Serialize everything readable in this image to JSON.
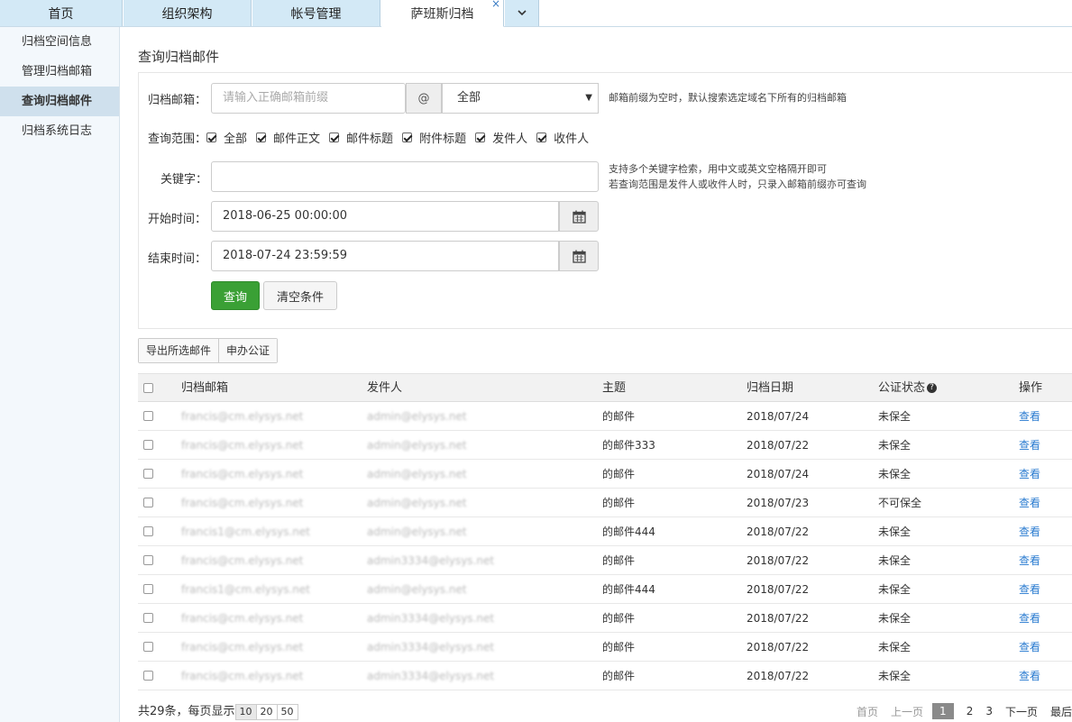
{
  "tabs": [
    {
      "label": "首页"
    },
    {
      "label": "组织架构"
    },
    {
      "label": "帐号管理"
    },
    {
      "label": "萨班斯归档",
      "close": "×"
    }
  ],
  "tab_more_icon": "chevron-down-icon",
  "sidebar": {
    "items": [
      {
        "label": "归档空间信息"
      },
      {
        "label": "管理归档邮箱"
      },
      {
        "label": "查询归档邮件"
      },
      {
        "label": "归档系统日志"
      }
    ]
  },
  "page_title": "查询归档邮件",
  "form": {
    "mailbox_label": "归档邮箱：",
    "mailbox_placeholder": "请输入正确邮箱前缀",
    "at_symbol": "@",
    "domain_selected": "全部",
    "mailbox_hint": "邮箱前缀为空时，默认搜索选定域名下所有的归档邮箱",
    "scope_label": "查询范围：",
    "scope_options": [
      {
        "label": "全部",
        "checked": true
      },
      {
        "label": "邮件正文",
        "checked": true
      },
      {
        "label": "邮件标题",
        "checked": true
      },
      {
        "label": "附件标题",
        "checked": true
      },
      {
        "label": "发件人",
        "checked": true
      },
      {
        "label": "收件人",
        "checked": true
      }
    ],
    "keyword_label": "关键字：",
    "keyword_value": "",
    "keyword_hint_1": "支持多个关键字检索，用中文或英文空格隔开即可",
    "keyword_hint_2": "若查询范围是发件人或收件人时，只录入邮箱前缀亦可查询",
    "start_label": "开始时间：",
    "start_value": "2018-06-25 00:00:00",
    "end_label": "结束时间：",
    "end_value": "2018-07-24 23:59:59",
    "calendar_icon": "calendar-icon",
    "search_button": "查询",
    "clear_button": "清空条件"
  },
  "actions": {
    "export_button": "导出所选邮件",
    "notarize_button": "申办公证"
  },
  "table": {
    "headers": {
      "mailbox": "归档邮箱",
      "sender": "发件人",
      "subject": "主题",
      "date": "归档日期",
      "status": "公证状态",
      "action": "操作"
    },
    "help_icon": "question-circle-icon",
    "rows": [
      {
        "mailbox": "francis@cm.elysys.net",
        "sender": "admin@elysys.net",
        "subject": "的邮件",
        "date": "2018/07/24",
        "status": "未保全",
        "action": "查看"
      },
      {
        "mailbox": "francis@cm.elysys.net",
        "sender": "admin@elysys.net",
        "subject": "的邮件333",
        "date": "2018/07/22",
        "status": "未保全",
        "action": "查看"
      },
      {
        "mailbox": "francis@cm.elysys.net",
        "sender": "admin@elysys.net",
        "subject": "的邮件",
        "date": "2018/07/24",
        "status": "未保全",
        "action": "查看"
      },
      {
        "mailbox": "francis@cm.elysys.net",
        "sender": "admin@elysys.net",
        "subject": "的邮件",
        "date": "2018/07/23",
        "status": "不可保全",
        "action": "查看"
      },
      {
        "mailbox": "francis1@cm.elysys.net",
        "sender": "admin@elysys.net",
        "subject": "的邮件444",
        "date": "2018/07/22",
        "status": "未保全",
        "action": "查看"
      },
      {
        "mailbox": "francis@cm.elysys.net",
        "sender": "admin3334@elysys.net",
        "subject": "的邮件",
        "date": "2018/07/22",
        "status": "未保全",
        "action": "查看"
      },
      {
        "mailbox": "francis1@cm.elysys.net",
        "sender": "admin@elysys.net",
        "subject": "的邮件444",
        "date": "2018/07/22",
        "status": "未保全",
        "action": "查看"
      },
      {
        "mailbox": "francis@cm.elysys.net",
        "sender": "admin3334@elysys.net",
        "subject": "的邮件",
        "date": "2018/07/22",
        "status": "未保全",
        "action": "查看"
      },
      {
        "mailbox": "francis@cm.elysys.net",
        "sender": "admin3334@elysys.net",
        "subject": "的邮件",
        "date": "2018/07/22",
        "status": "未保全",
        "action": "查看"
      },
      {
        "mailbox": "francis@cm.elysys.net",
        "sender": "admin3334@elysys.net",
        "subject": "的邮件",
        "date": "2018/07/22",
        "status": "未保全",
        "action": "查看"
      }
    ]
  },
  "footer": {
    "total_text": "共29条，每页显示",
    "page_sizes": [
      "10",
      "20",
      "50"
    ],
    "pager": {
      "first": "首页",
      "prev": "上一页",
      "pages": [
        "1",
        "2",
        "3"
      ],
      "next": "下一页",
      "last": "最后"
    }
  },
  "colors": {
    "tab_bg": "#d3e9f6",
    "sidebar_bg": "#f3f8fc",
    "primary_green": "#3aa035",
    "link_blue": "#2a7bd0"
  }
}
